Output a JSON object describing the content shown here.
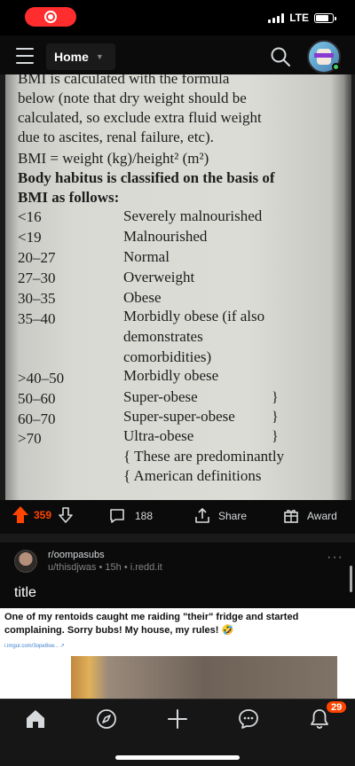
{
  "status_bar": {
    "network": "LTE",
    "battery_level": 0.8
  },
  "header": {
    "feed_label": "Home"
  },
  "post1": {
    "image_text": {
      "lines": [
        "BMI is calculated with the formula",
        "below (note that dry weight should be",
        "calculated, so exclude extra fluid weight",
        "due to ascites, renal failure, etc).",
        "BMI = weight (kg)/height² (m²)"
      ],
      "bold_lines": [
        "Body habitus is classified on the basis of",
        "BMI as follows:"
      ],
      "rows": [
        {
          "range": "<16",
          "label": "Severely malnourished"
        },
        {
          "range": "<19",
          "label": "Malnourished"
        },
        {
          "range": "20–27",
          "label": "Normal"
        },
        {
          "range": "27–30",
          "label": "Overweight"
        },
        {
          "range": "30–35",
          "label": "Obese"
        },
        {
          "range": "35–40",
          "label": "Morbidly obese (if also"
        },
        {
          "range": "",
          "label": "demonstrates"
        },
        {
          "range": "",
          "label": "comorbidities)"
        },
        {
          "range": ">40–50",
          "label": "Morbidly obese"
        },
        {
          "range": "50–60",
          "label": "Super-obese"
        },
        {
          "range": "60–70",
          "label": "Super-super-obese"
        },
        {
          "range": ">70",
          "label": "Ultra-obese"
        }
      ],
      "footnote": [
        "{ These are predominantly",
        "{ American definitions"
      ]
    },
    "votes": "359",
    "comments": "188",
    "share_label": "Share",
    "award_label": "Award"
  },
  "post2": {
    "subreddit": "r/oompasubs",
    "author": "u/thisdjwas",
    "age": "15h",
    "domain": "i.redd.it",
    "more_label": "···",
    "title": "title",
    "embed_text": "One of my rentoids caught me raiding \"their\" fridge and started complaining. Sorry bubs! My house, my rules! 🤣",
    "embed_link": "i.imgur.com/3ope8sw... ↗"
  },
  "bottom_nav": {
    "notification_count": "29"
  },
  "icons": {
    "menu": "menu-icon",
    "search": "search-icon",
    "upvote": "upvote-icon",
    "downvote": "downvote-icon",
    "comment": "comment-icon",
    "share": "share-icon",
    "award": "award-icon",
    "home": "home-icon",
    "discover": "compass-icon",
    "create": "plus-icon",
    "chat": "chat-icon",
    "inbox": "bell-icon"
  },
  "colors": {
    "accent": "#ff4500",
    "background": "#000000",
    "online": "#46d160"
  }
}
